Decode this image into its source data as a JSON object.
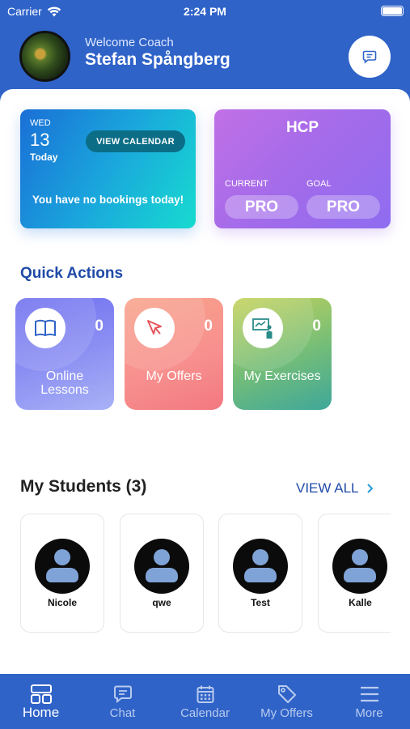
{
  "status": {
    "carrier": "Carrier",
    "time": "2:24 PM"
  },
  "header": {
    "welcome": "Welcome Coach",
    "name": "Stefan Spångberg"
  },
  "calendar_card": {
    "weekday": "WED",
    "date": "13",
    "today_label": "Today",
    "view_button": "VIEW CALENDAR",
    "message": "You have no bookings today!"
  },
  "hcp_card": {
    "title": "HCP",
    "current_label": "CURRENT",
    "goal_label": "GOAL",
    "current_value": "PRO",
    "goal_value": "PRO"
  },
  "quick_actions": {
    "title": "Quick Actions",
    "items": [
      {
        "label": "Online Lessons",
        "count": "0",
        "icon": "book-icon"
      },
      {
        "label": "My Offers",
        "count": "0",
        "icon": "cursor-icon"
      },
      {
        "label": "My Exercises",
        "count": "0",
        "icon": "presentation-icon"
      }
    ]
  },
  "students": {
    "title": "My Students (3)",
    "view_all": "VIEW ALL",
    "items": [
      {
        "name": "Nicole"
      },
      {
        "name": "qwe"
      },
      {
        "name": "Test"
      },
      {
        "name": "Kalle"
      }
    ]
  },
  "tabs": [
    {
      "label": "Home",
      "icon": "home-grid-icon",
      "active": true
    },
    {
      "label": "Chat",
      "icon": "chat-icon",
      "active": false
    },
    {
      "label": "Calendar",
      "icon": "calendar-icon",
      "active": false
    },
    {
      "label": "My Offers",
      "icon": "tag-icon",
      "active": false
    },
    {
      "label": "More",
      "icon": "menu-icon",
      "active": false
    }
  ],
  "colors": {
    "brand_blue": "#2f63c8",
    "title_blue": "#1f4aa8"
  }
}
